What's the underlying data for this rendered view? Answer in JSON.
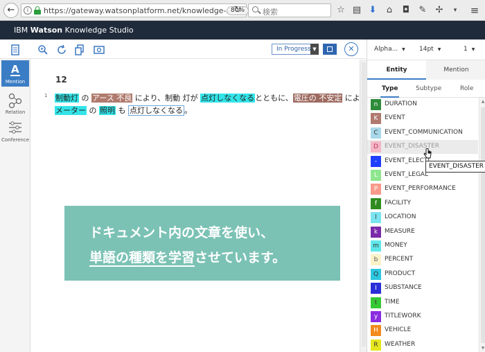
{
  "browser": {
    "back_glyph": "←",
    "info_glyph": "i",
    "url": "https://gateway.watsonplatform.net/knowledge-stud",
    "zoom": "80%",
    "reload_glyph": "↻",
    "search_placeholder": "検索",
    "toolbar_glyphs": [
      "☆",
      "▤",
      "⬇",
      "⌂",
      "◘",
      "✎",
      "✢",
      "▾",
      "≡"
    ]
  },
  "app": {
    "title_prefix": "IBM ",
    "title_bold": "Watson",
    "title_rest": " Knowledge Studio"
  },
  "left_rail": {
    "items": [
      {
        "label": "Mention",
        "active": true
      },
      {
        "label": "Relation",
        "active": false
      },
      {
        "label": "Conference",
        "active": false
      }
    ]
  },
  "toolbar": {
    "status_value": "In Progress",
    "close_glyph": "✕"
  },
  "document": {
    "number": "12",
    "line_number": "1",
    "sentence1": [
      {
        "text": "制動灯",
        "style": "cyan"
      },
      {
        "text": " の ",
        "style": "plain"
      },
      {
        "text": "アース 不良",
        "style": "brown"
      },
      {
        "text": " により、制動 灯が ",
        "style": "plain"
      },
      {
        "text": "点灯しなくなる",
        "style": "cyan"
      },
      {
        "text": "とともに、",
        "style": "plain"
      },
      {
        "text": "電圧の 不安定",
        "style": "brown-dark"
      },
      {
        "text": " により",
        "style": "plain"
      }
    ],
    "sentence2": [
      {
        "text": "メーター",
        "style": "cyan"
      },
      {
        "text": " の ",
        "style": "plain"
      },
      {
        "text": "照明",
        "style": "cyan"
      },
      {
        "text": " も ",
        "style": "plain"
      },
      {
        "text": "点灯しなくなる",
        "style": "outline"
      },
      {
        "text": "。",
        "style": "plain"
      }
    ]
  },
  "overlay": {
    "line1": "ドキュメント内の文章を使い、",
    "line2_underlined": "単語の種類を学習",
    "line2_rest": "させています。",
    "color": "#7bc2b5"
  },
  "panel": {
    "sort_select": "Alpha...",
    "font_select": "14pt",
    "level_select": "1",
    "tabs": [
      "Entity",
      "Mention"
    ],
    "sub_tabs": [
      "Type",
      "Subtype",
      "Role"
    ],
    "types": [
      {
        "letter": "n",
        "name": "DURATION",
        "bg": "#2e8b3a",
        "fg": "#fff"
      },
      {
        "letter": "K",
        "name": "EVENT",
        "bg": "#b07a6e",
        "fg": "#fff"
      },
      {
        "letter": "C",
        "name": "EVENT_COMMUNICATION",
        "bg": "#a8d8ea",
        "fg": "#333"
      },
      {
        "letter": "D",
        "name": "EVENT_DISASTER",
        "bg": "#f2b7c6",
        "fg": "#c0395a",
        "hover": true
      },
      {
        "letter": "-",
        "name": "EVENT_ELECTI...",
        "bg": "#1f3fff",
        "fg": "#fff"
      },
      {
        "letter": "L",
        "name": "EVENT_LEGAL",
        "bg": "#8ee68e",
        "fg": "#fff"
      },
      {
        "letter": "P",
        "name": "EVENT_PERFORMANCE",
        "bg": "#f79a8a",
        "fg": "#fff"
      },
      {
        "letter": "f",
        "name": "FACILITY",
        "bg": "#2e8b1f",
        "fg": "#fff"
      },
      {
        "letter": "l",
        "name": "LOCATION",
        "bg": "#7ae3f0",
        "fg": "#333"
      },
      {
        "letter": "k",
        "name": "MEASURE",
        "bg": "#7a2aa8",
        "fg": "#fff"
      },
      {
        "letter": "m",
        "name": "MONEY",
        "bg": "#5fe7ea",
        "fg": "#333"
      },
      {
        "letter": "b",
        "name": "PERCENT",
        "bg": "#fbf2c8",
        "fg": "#555"
      },
      {
        "letter": "Q",
        "name": "PRODUCT",
        "bg": "#2cc7e0",
        "fg": "#333"
      },
      {
        "letter": "I",
        "name": "SUBSTANCE",
        "bg": "#2a2ed8",
        "fg": "#fff"
      },
      {
        "letter": "t",
        "name": "TIME",
        "bg": "#36c936",
        "fg": "#333"
      },
      {
        "letter": "y",
        "name": "TITLEWORK",
        "bg": "#8a2ce0",
        "fg": "#fff"
      },
      {
        "letter": "H",
        "name": "VEHICLE",
        "bg": "#f28a1e",
        "fg": "#fff"
      },
      {
        "letter": "R",
        "name": "WEATHER",
        "bg": "#e7e71f",
        "fg": "#333"
      }
    ],
    "tooltip": "EVENT_DISASTER"
  }
}
